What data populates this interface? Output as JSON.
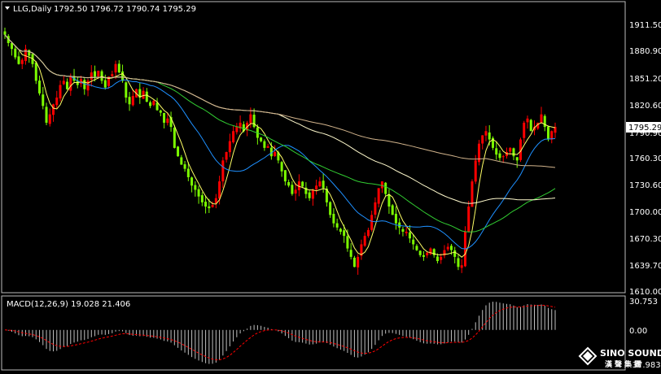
{
  "header": {
    "symbol": "LLG,Daily",
    "ohlc": "1792.50 1796.72 1790.74 1795.29"
  },
  "macd_header": "MACD(12,26,9) 19.028 21.406",
  "current_price": "1795.29",
  "price_axis": [
    "1911.50",
    "1880.90",
    "1851.20",
    "1820.60",
    "1790.90",
    "1760.30",
    "1730.60",
    "1700.00",
    "1670.30",
    "1639.70",
    "1610.00"
  ],
  "macd_axis": [
    "30.753",
    "0.00",
    "-37.983"
  ],
  "logo": {
    "brand": "SINO SOUND",
    "sub": "漢聲集團"
  },
  "colors": {
    "up": "#ff0000",
    "down": "#7cfc00",
    "ma_fast": "#ffff66",
    "ma_mid": "#1e90ff",
    "ma_slow": "#32cd32",
    "ma_long": "#fffacd",
    "ma_longest": "#d2b48c",
    "signal": "#ff0000"
  },
  "chart_data": {
    "type": "candlestick",
    "ylim": [
      1605,
      1927
    ],
    "closes": [
      1905,
      1895,
      1888,
      1878,
      1870,
      1875,
      1888,
      1880,
      1870,
      1850,
      1835,
      1820,
      1800,
      1810,
      1822,
      1830,
      1845,
      1850,
      1840,
      1855,
      1850,
      1845,
      1852,
      1840,
      1850,
      1860,
      1855,
      1862,
      1850,
      1842,
      1855,
      1858,
      1870,
      1860,
      1850,
      1830,
      1822,
      1832,
      1840,
      1830,
      1838,
      1825,
      1820,
      1826,
      1815,
      1812,
      1800,
      1805,
      1795,
      1770,
      1760,
      1750,
      1745,
      1735,
      1725,
      1720,
      1712,
      1705,
      1700,
      1698,
      1702,
      1710,
      1730,
      1755,
      1765,
      1778,
      1790,
      1795,
      1800,
      1790,
      1800,
      1810,
      1795,
      1782,
      1778,
      1770,
      1772,
      1760,
      1765,
      1755,
      1742,
      1730,
      1725,
      1715,
      1720,
      1730,
      1724,
      1715,
      1710,
      1720,
      1725,
      1730,
      1722,
      1705,
      1690,
      1680,
      1675,
      1670,
      1665,
      1650,
      1640,
      1628,
      1640,
      1655,
      1665,
      1672,
      1690,
      1705,
      1722,
      1730,
      1715,
      1700,
      1690,
      1680,
      1675,
      1670,
      1670,
      1662,
      1655,
      1648,
      1642,
      1640,
      1645,
      1650,
      1642,
      1635,
      1640,
      1648,
      1652,
      1648,
      1640,
      1628,
      1630,
      1670,
      1700,
      1730,
      1755,
      1775,
      1785,
      1790,
      1780,
      1770,
      1762,
      1758,
      1760,
      1765,
      1770,
      1760,
      1755,
      1780,
      1800,
      1805,
      1790,
      1795,
      1800,
      1810,
      1795,
      1780,
      1790,
      1795
    ],
    "macd_signal_last": 21.406,
    "macd_last": 19.028
  }
}
